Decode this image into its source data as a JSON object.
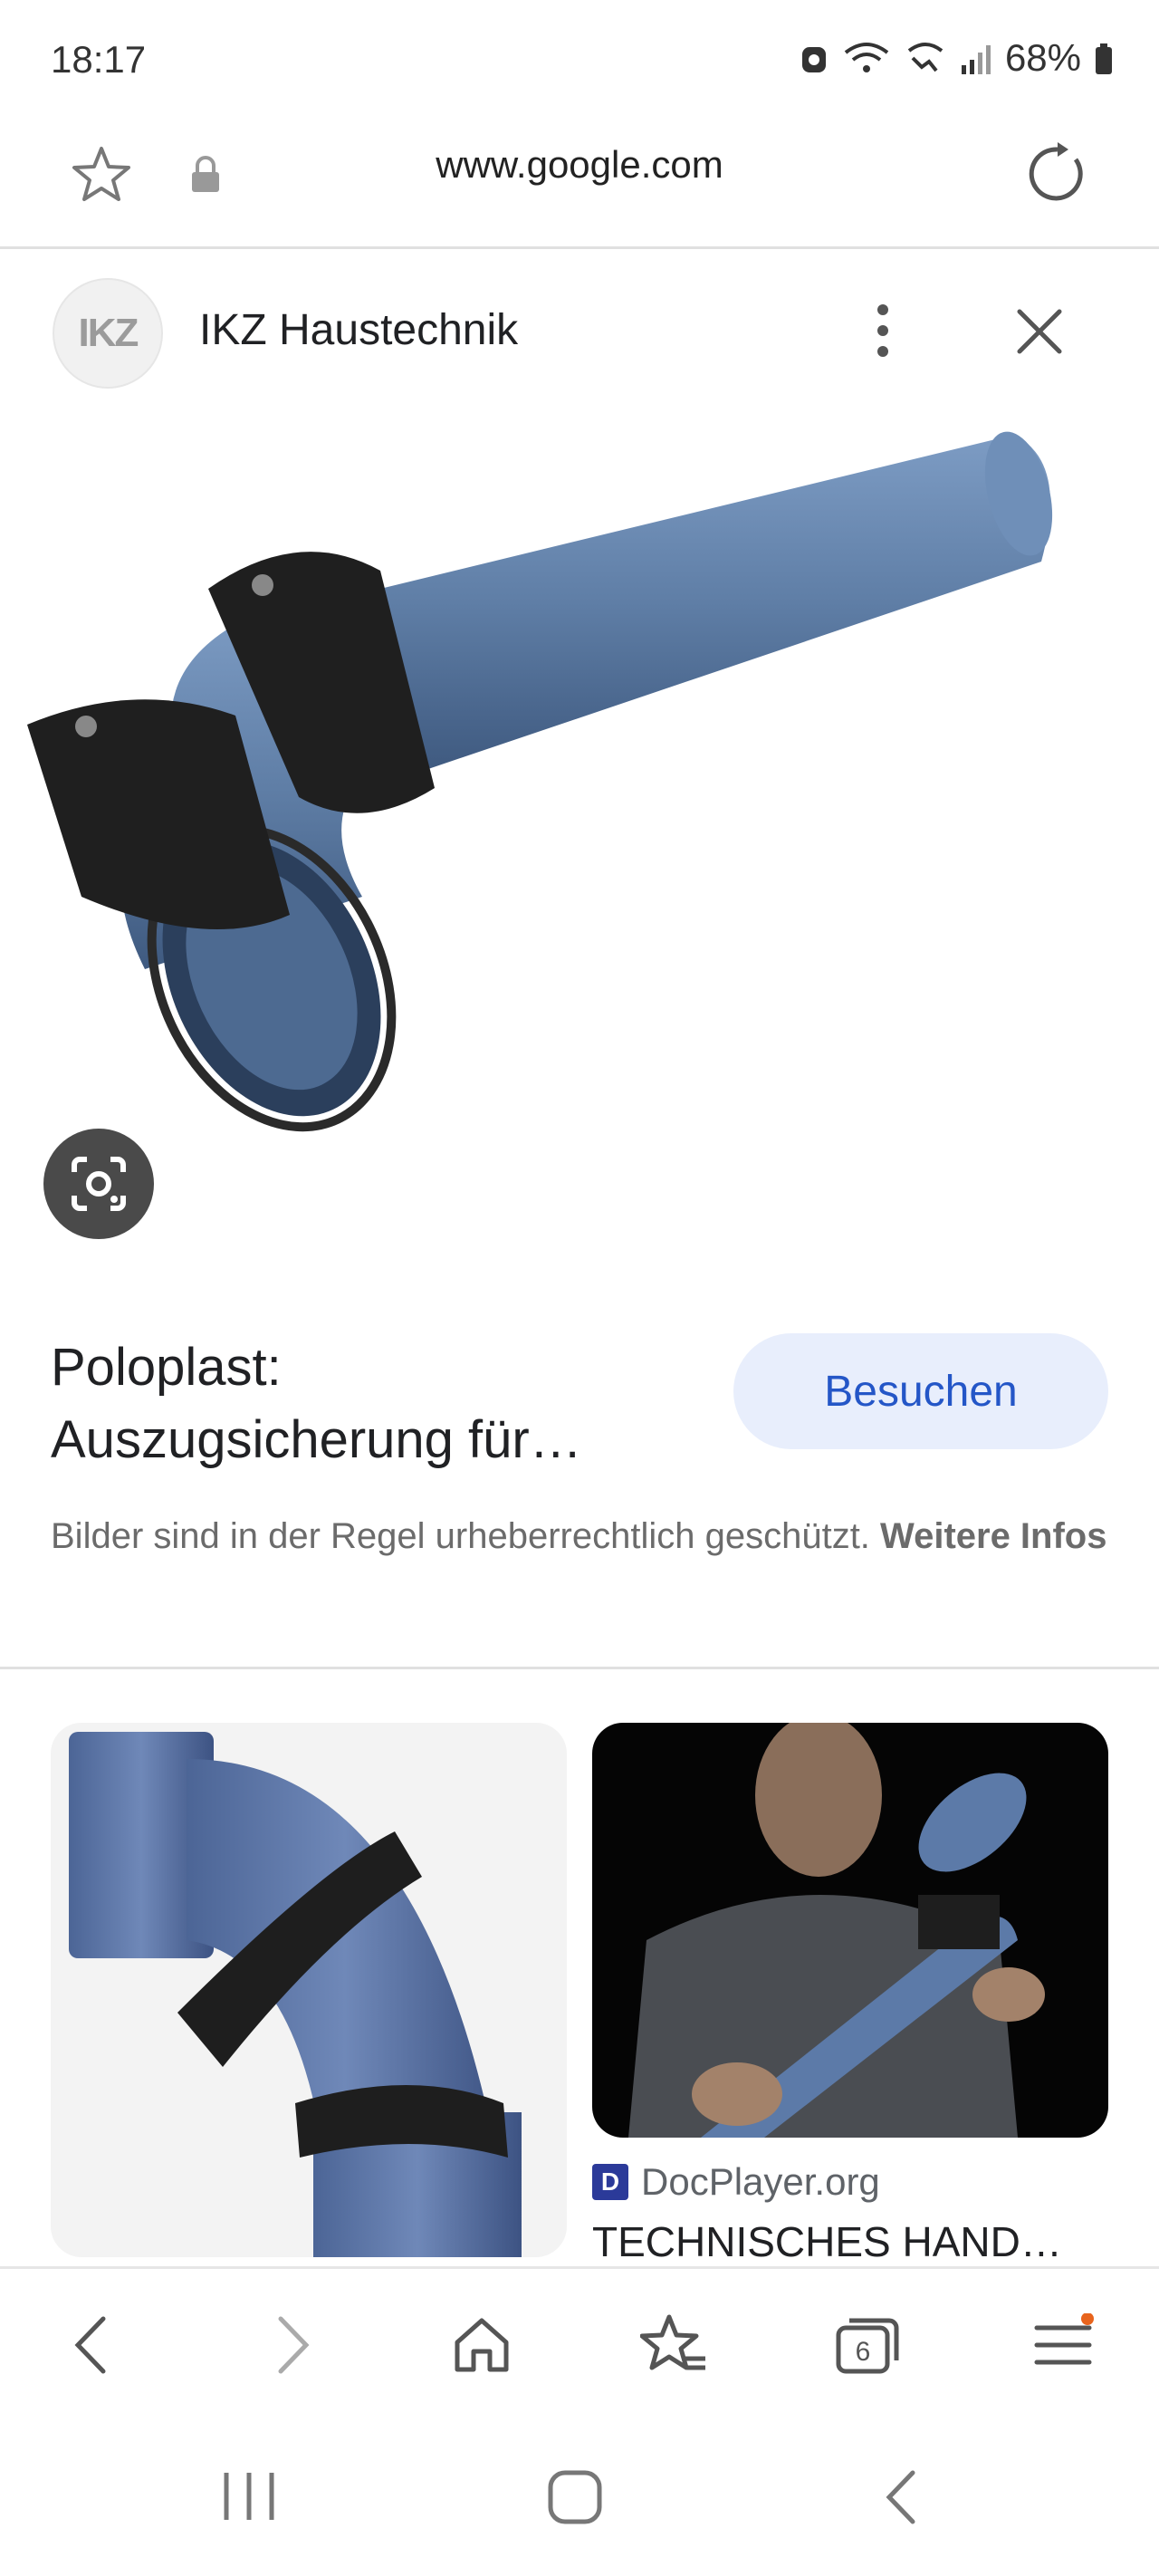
{
  "status_bar": {
    "time": "18:17",
    "battery": "68%"
  },
  "browser": {
    "url": "www.google.com",
    "tab_count": "6"
  },
  "source": {
    "logo_text": "IKZ",
    "name": "IKZ Haustechnik"
  },
  "result": {
    "title_line1": "Poloplast:",
    "title_line2": "Auszugsicherung für…",
    "visit_label": "Besuchen",
    "copyright_text": "Bilder sind in der Regel urheberrechtlich geschützt. ",
    "copyright_link": "Weitere Infos"
  },
  "related": [
    {
      "site": "",
      "title": ""
    },
    {
      "site_icon_letter": "D",
      "site": "DocPlayer.org",
      "title": "TECHNISCHES HAND…"
    }
  ],
  "colors": {
    "pipe_blue": "#5f7ea6",
    "clamp_black": "#1f1f1f",
    "accent_blue": "#2456c7",
    "visit_bg": "#e8eefc"
  }
}
